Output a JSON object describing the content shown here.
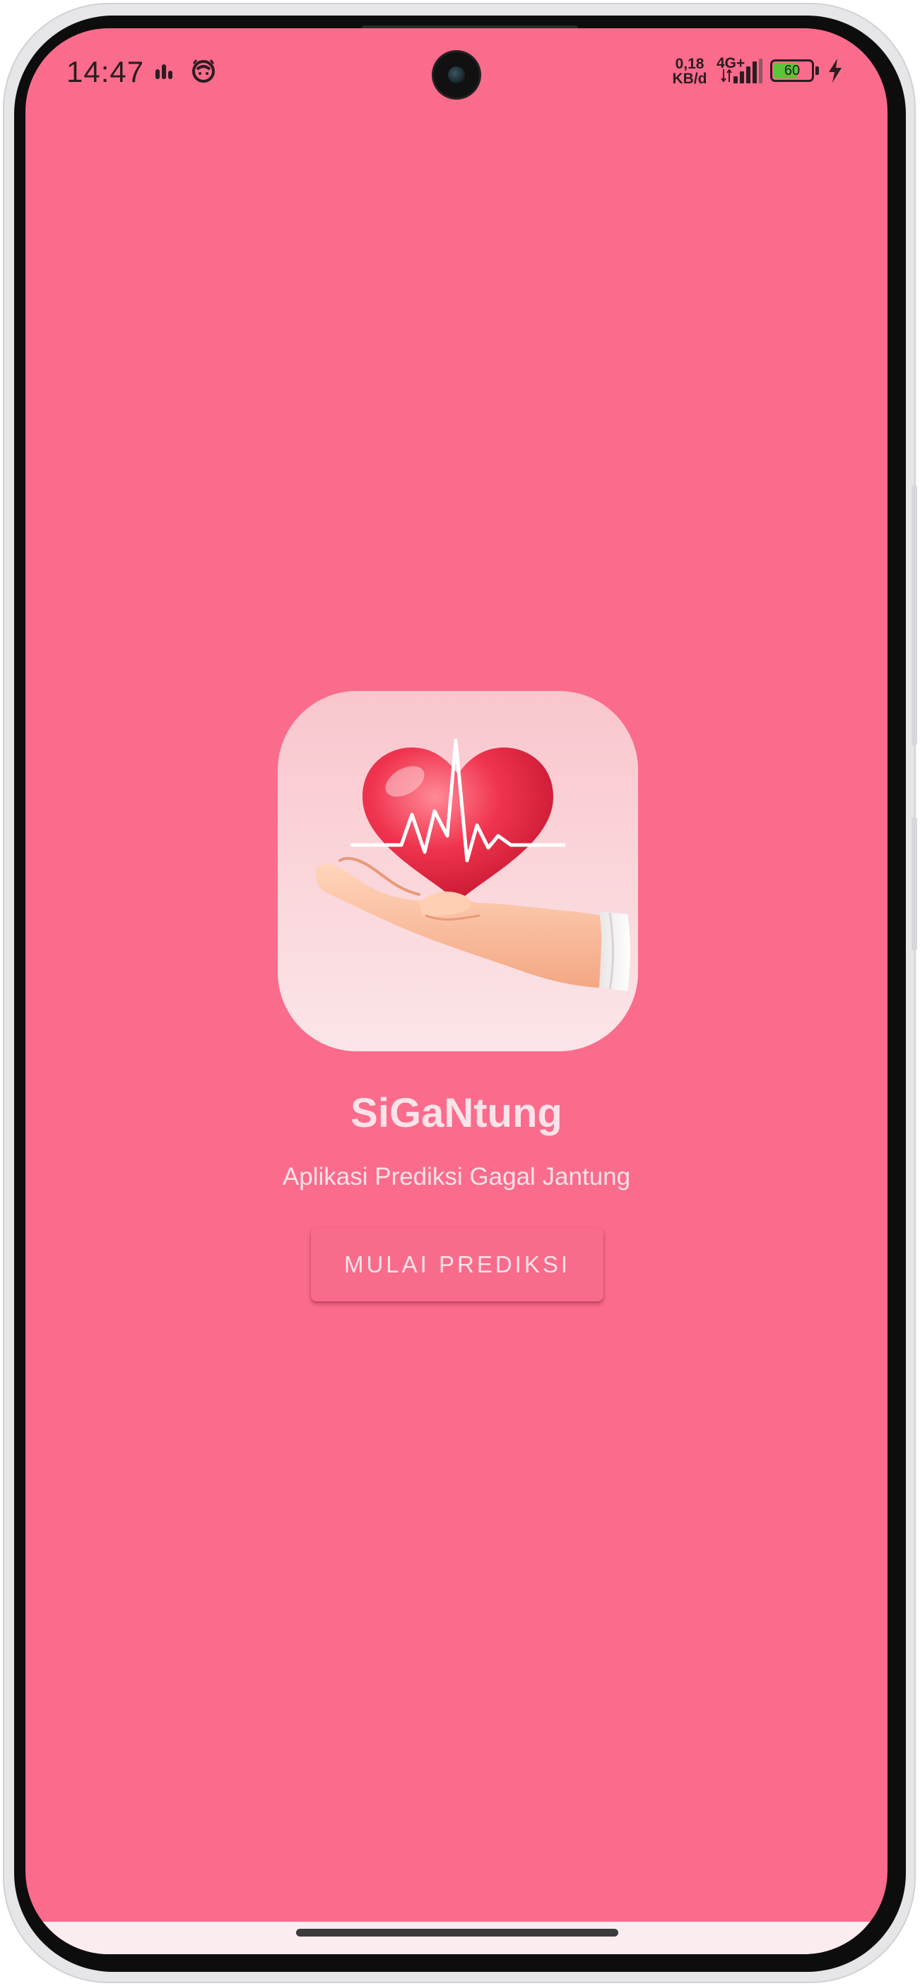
{
  "status_bar": {
    "time": "14:47",
    "net_speed_value": "0,18",
    "net_speed_unit": "KB/d",
    "network_type": "4G+",
    "battery_level": "60",
    "battery_fraction": 0.6,
    "icons": [
      "activity-bars-icon",
      "alarm-face-icon",
      "signal-strength-icon",
      "battery-icon",
      "charging-bolt-icon"
    ]
  },
  "app": {
    "title": "SiGaNtung",
    "subtitle": "Aplikasi Prediksi Gagal Jantung",
    "start_button_label": "MULAI PREDIKSI",
    "logo_icon": "heart-in-hand-heartbeat-icon"
  },
  "colors": {
    "background": "#fb6b8b",
    "text": "#fbe3e9",
    "button": "#f86b8a"
  }
}
